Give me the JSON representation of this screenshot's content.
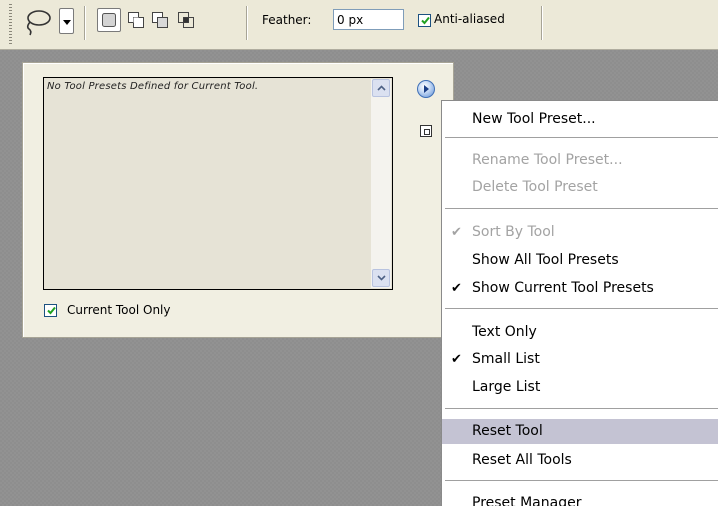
{
  "options_bar": {
    "feather_label": "Feather:",
    "feather_value": "0 px",
    "antialiased_label": "Anti-aliased",
    "antialiased_checked": true
  },
  "preset_panel": {
    "empty_message": "No Tool Presets Defined for Current Tool.",
    "current_tool_only_label": "Current Tool Only",
    "current_tool_only_checked": true
  },
  "menu": {
    "new_tool_preset": "New Tool Preset...",
    "rename_tool_preset": "Rename Tool Preset...",
    "delete_tool_preset": "Delete Tool Preset",
    "sort_by_tool": "Sort By Tool",
    "show_all_tool_presets": "Show All Tool Presets",
    "show_current_tool_presets": "Show Current Tool Presets",
    "text_only": "Text Only",
    "small_list": "Small List",
    "large_list": "Large List",
    "reset_tool": "Reset Tool",
    "reset_all_tools": "Reset All Tools",
    "preset_manager": "Preset Manager",
    "check_glyph": "✔"
  },
  "colors": {
    "menu_highlight": "#c4c3d3",
    "disabled_text": "#a3a3a3",
    "checkbox_border": "#1c5180",
    "checkbox_tick": "#21a121"
  }
}
